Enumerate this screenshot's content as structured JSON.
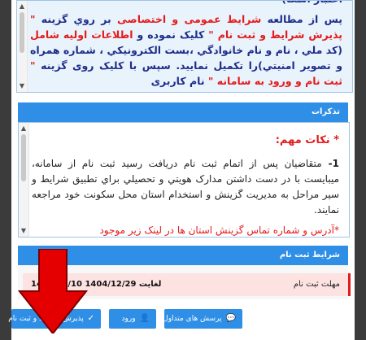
{
  "top_box": {
    "line0": "اعتبار است)",
    "p_a_navy": "پس از مطالعه ",
    "p_b_red": "شرایط عمومی و اختصاصی",
    "p_c_navy": " بر روي گزينه ",
    "p_d_red": "\" پذيرش شرايط و ثبت نام \"",
    "p_e_navy": " کلیک نموده و ",
    "p_f_red": "اطلاعات اولیه شامل",
    "p_g_navy": " (کد ملي ، نام و نام خانوادگي ،بست الکترونيکي ، شماره همراه و تصوير امنيتي)را تکميل نماييد. سپس با کلیک روی گزینه ",
    "p_h_red": "\" ثبت نام و ورود به سامانه \"",
    "p_i_navy": " نام کاربری"
  },
  "notes": {
    "header": "تذکرات",
    "title": "* نکات مهم:",
    "item1_num": "1- ",
    "item1_text": "متقاضیان پس از اتمام ثبت نام دریافت رسید ثبت نام از سامانه، میبایست با در دست داشتن مدارک هویتي و تحصيلي براي تطبيق شرايط و سير مراحل به مديريت گزينش و استخدام استان محل سکونت خود مراجعه نمايند.",
    "item2_cut": "*آدرس و شماره تماس گزینش استان ها در لینک زیر موجود"
  },
  "conditions": {
    "header": "شرایط ثبت نام",
    "deadline_label": "مهلت ثبت نام",
    "deadline_value": "1404/08/10 لغایت 1404/12/29"
  },
  "buttons": {
    "accept": "پذيرش شرايط و ثبت نام",
    "login": "ورود",
    "faq": "پرسش های متداول"
  },
  "colors": {
    "primary": "#2f8fe6",
    "red": "#e41b1b",
    "navy": "#1f2d8a"
  }
}
